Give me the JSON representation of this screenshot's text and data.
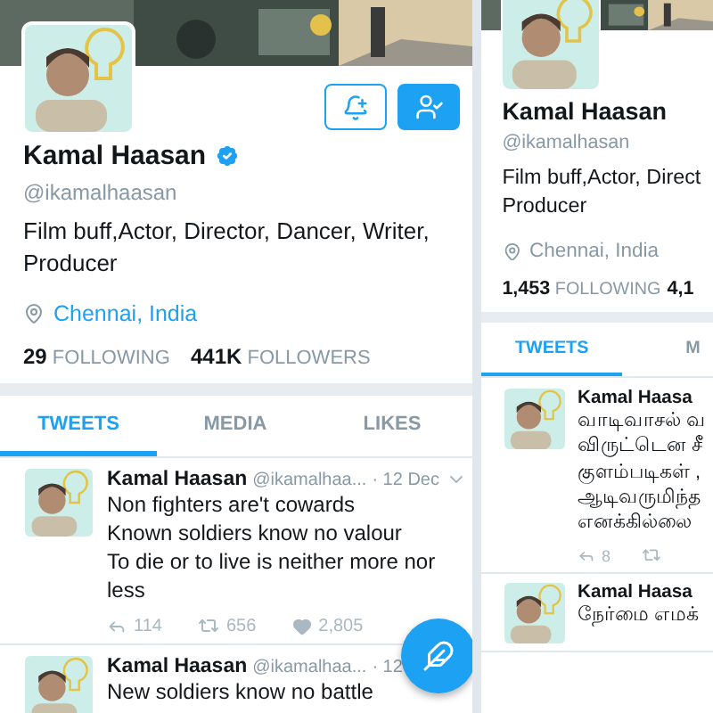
{
  "screens": [
    {
      "name": "Kamal Haasan",
      "verified": true,
      "handle": "@ikamalhaasan",
      "bio": [
        "Film buff,Actor, Director, Dancer, Writer,",
        "Producer"
      ],
      "location": "Chennai, India",
      "location_linked": true,
      "buttons": [
        {
          "kind": "notify"
        },
        {
          "kind": "following"
        }
      ],
      "stats": [
        {
          "count": "29",
          "label": "FOLLOWING"
        },
        {
          "count": "441K",
          "label": "FOLLOWERS"
        }
      ],
      "tabs": [
        {
          "label": "TWEETS",
          "selected": true
        },
        {
          "label": "MEDIA",
          "selected": false
        },
        {
          "label": "LIKES",
          "selected": false
        }
      ],
      "tweets": [
        {
          "name": "Kamal Haasan",
          "handle": "@ikamalhaa...",
          "time": "· 12 Dec",
          "menu": true,
          "lines": [
            "Non fighters are't cowards",
            "Known soldiers know no valour",
            "To die or to live is neither more nor",
            "less"
          ],
          "actions": [
            {
              "kind": "reply",
              "count": "114"
            },
            {
              "kind": "retweet",
              "count": "656"
            },
            {
              "kind": "like",
              "count": "2,805"
            }
          ]
        },
        {
          "name": "Kamal Haasan",
          "handle": "@ikamalhaa...",
          "time": "· 12",
          "lines": [
            "New soldiers know no battle"
          ]
        }
      ],
      "fab": {
        "kind": "compose"
      }
    },
    {
      "name": "Kamal Haasan",
      "handle": "@ikamalhasan",
      "bio": [
        "Film buff,Actor, Direct",
        "Producer"
      ],
      "location": "Chennai, India",
      "location_linked": false,
      "stats": [
        {
          "count": "1,453",
          "label": "FOLLOWING"
        },
        {
          "count": "4,1"
        }
      ],
      "tabs": [
        {
          "label": "TWEETS",
          "selected": true
        },
        {
          "label": "M",
          "selected": false
        }
      ],
      "tweets": [
        {
          "name": "Kamal Haasa",
          "lines": [
            "வாடிவாசல் வ",
            "விருட்டென சீ",
            "குளம்படிகள் ,",
            "ஆடிவருமிந்த",
            "எனக்கில்லை"
          ],
          "actions": [
            {
              "kind": "reply",
              "count": "8"
            },
            {
              "kind": "retweet"
            }
          ]
        },
        {
          "name": "Kamal Haasa",
          "lines": [
            "நேர்மை எமக்"
          ]
        }
      ]
    }
  ]
}
